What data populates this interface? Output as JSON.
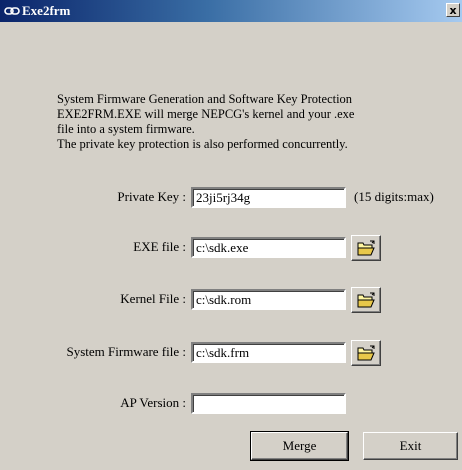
{
  "window": {
    "title": "Exe2frm",
    "close_label": "x"
  },
  "description": {
    "lines": [
      "System Firmware Generation and Software Key Protection",
      "EXE2FRM.EXE will merge NEPCG's kernel and your .exe",
      "file into a system firmware.",
      "The private key protection is also performed concurrently."
    ]
  },
  "form": {
    "private_key": {
      "label": "Private Key :",
      "value": "23ji5rj34g",
      "hint": "(15 digits:max)"
    },
    "exe_file": {
      "label": "EXE file :",
      "value": "c:\\sdk.exe"
    },
    "kernel_file": {
      "label": "Kernel File :",
      "value": "c:\\sdk.rom"
    },
    "system_firmware_file": {
      "label": "System Firmware file :",
      "value": "c:\\sdk.frm"
    },
    "ap_version": {
      "label": "AP Version :",
      "value": ""
    }
  },
  "buttons": {
    "merge": "Merge",
    "exit": "Exit"
  },
  "icons": {
    "app": "chain-link-icon",
    "browse": "open-folder-icon"
  }
}
